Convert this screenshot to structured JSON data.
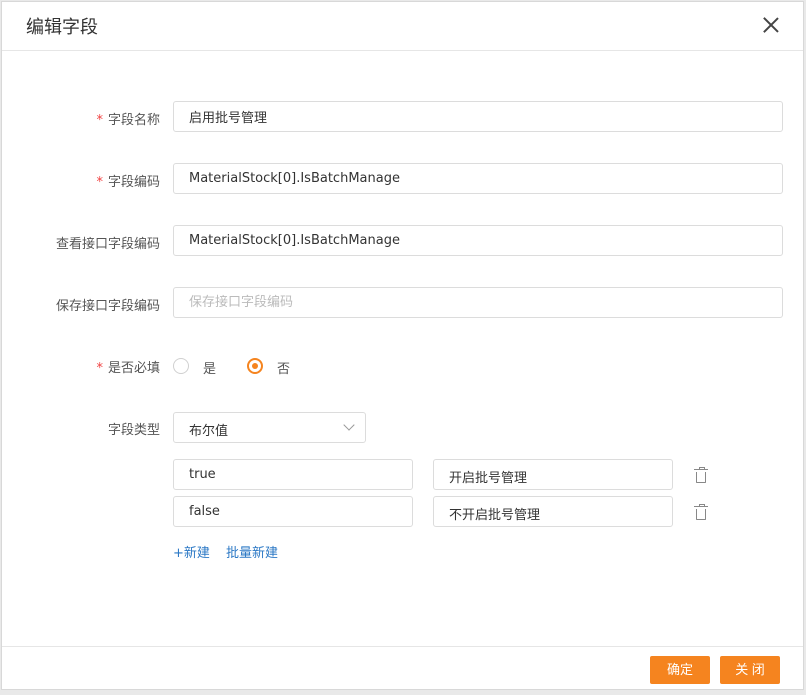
{
  "dialog": {
    "title": "编辑字段"
  },
  "form": {
    "field_name": {
      "label": "字段名称",
      "value": "启用批号管理",
      "required": true
    },
    "field_code": {
      "label": "字段编码",
      "value": "MaterialStock[0].IsBatchManage",
      "required": true
    },
    "view_api_code": {
      "label": "查看接口字段编码",
      "value": "MaterialStock[0].IsBatchManage"
    },
    "save_api_code": {
      "label": "保存接口字段编码",
      "value": "",
      "placeholder": "保存接口字段编码"
    },
    "required_field": {
      "label": "是否必填",
      "options": [
        "是",
        "否"
      ],
      "selected": "否",
      "required": true
    },
    "field_type": {
      "label": "字段类型",
      "value": "布尔值"
    }
  },
  "options": [
    {
      "value": "true",
      "text": "开启批号管理"
    },
    {
      "value": "false",
      "text": "不开启批号管理"
    }
  ],
  "actions": {
    "add": "+新建",
    "batch_add": "批量新建"
  },
  "footer": {
    "confirm": "确定",
    "close": "关 闭"
  },
  "colors": {
    "accent": "#f5841f",
    "link": "#2b78c5",
    "required": "#f04040"
  }
}
